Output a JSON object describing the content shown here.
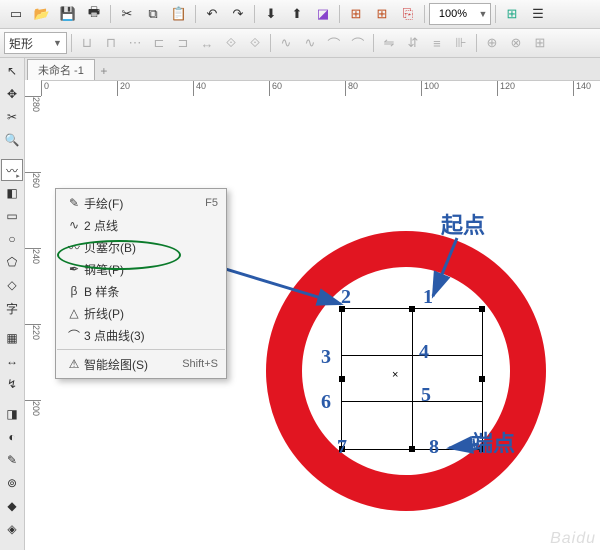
{
  "toolbar": {
    "zoom_value": "100%",
    "icons": [
      "new-doc",
      "open",
      "save",
      "print",
      "cut",
      "copy",
      "paste",
      "undo",
      "redo",
      "import",
      "export",
      "publish",
      "pdf"
    ]
  },
  "propbar": {
    "shape_label": "矩形"
  },
  "tabs": {
    "active": "未命名 -1"
  },
  "ruler": {
    "h": [
      "0",
      "20",
      "40",
      "60",
      "80",
      "100",
      "120",
      "140"
    ],
    "v": [
      "280",
      "260",
      "240",
      "220",
      "200"
    ]
  },
  "context_menu": {
    "items": [
      {
        "icon": "✎",
        "label": "手绘(F)",
        "key": "F5"
      },
      {
        "icon": "∿",
        "label": "2 点线",
        "key": ""
      },
      {
        "icon": "〰",
        "label": "贝塞尔(B)",
        "key": ""
      },
      {
        "icon": "✒",
        "label": "钢笔(P)",
        "key": ""
      },
      {
        "icon": "β",
        "label": "B 样条",
        "key": ""
      },
      {
        "icon": "△",
        "label": "折线(P)",
        "key": ""
      },
      {
        "icon": "⌒",
        "label": "3 点曲线(3)",
        "key": ""
      }
    ],
    "smart": {
      "icon": "⚠",
      "label": "智能绘图(S)",
      "key": "Shift+S"
    }
  },
  "annotations": {
    "start": "起点",
    "end": "端点",
    "n1": "1",
    "n2": "2",
    "n3": "3",
    "n4": "4",
    "n5": "5",
    "n6": "6",
    "n7": "7",
    "n8": "8"
  },
  "watermark": "Baidu"
}
